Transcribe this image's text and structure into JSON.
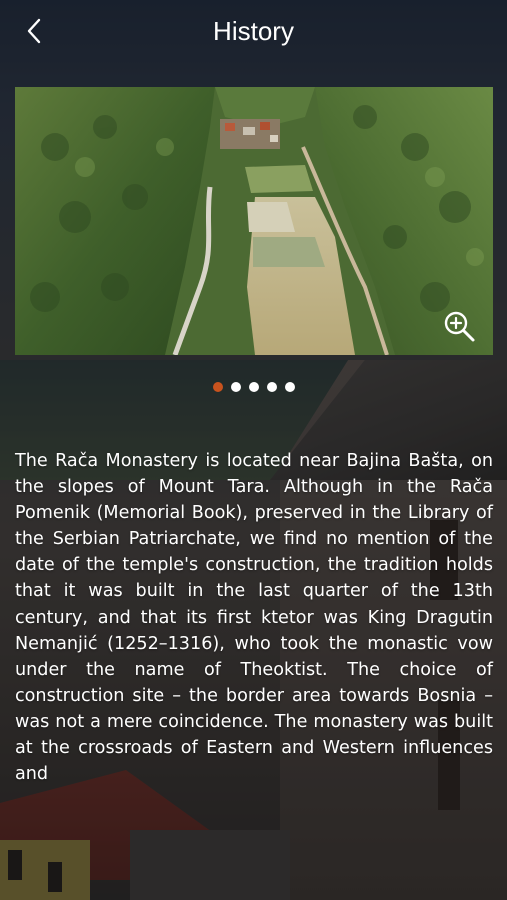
{
  "header": {
    "title": "History",
    "back_icon": "chevron-left-icon"
  },
  "hero": {
    "image_subject": "aerial view of river valley with village and forested hills",
    "zoom_icon": "zoom-in-icon"
  },
  "carousel": {
    "total": 5,
    "active_index": 0,
    "active_color": "#c8531e",
    "inactive_color": "#ffffff"
  },
  "body": {
    "text": "The Rača Monastery is located near Bajina Bašta, on the slopes of Mount Tara. Although in the Rača Pomenik (Memorial Book), preserved in the Library of the Serbian Patriarchate, we find no mention of the date of the temple's construction, the tradition holds that it was built in the last quarter of the 13th century, and that its first ktetor was King Dragutin Nemanjić (1252–1316), who took the monastic vow under the name of Theoktist. The choice of construction site – the border area towards Bosnia – was not a mere coincidence. The monastery was built at the crossroads of Eastern and Western influences and"
  }
}
